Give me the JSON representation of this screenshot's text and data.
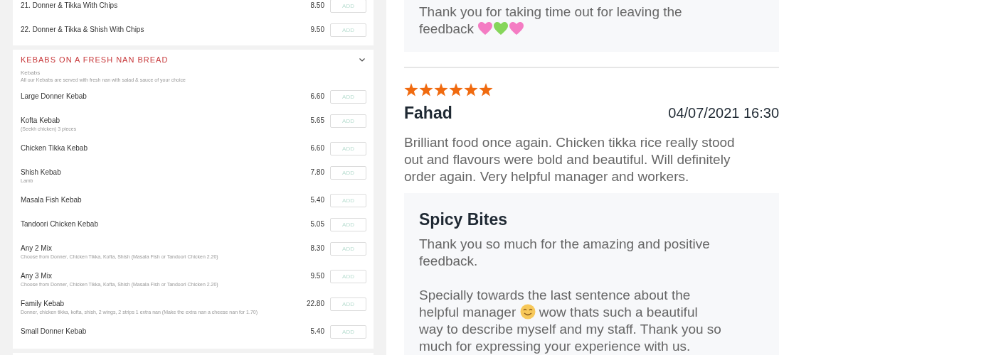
{
  "menu": {
    "previous_items": [
      {
        "name": "21. Donner & Tikka With Chips",
        "price": "8.50",
        "button": "ADD"
      },
      {
        "name": "22. Donner & Tikka & Shish With Chips",
        "price": "9.50",
        "button": "ADD"
      }
    ],
    "section": {
      "title": "KEBABS ON A FRESH NAN BREAD",
      "expanded": true,
      "category": "Kebabs",
      "description": "All our Kebabs are served with fresh nan with salad & sauce of your choice",
      "items": [
        {
          "name": "Large Donner Kebab",
          "price": "6.60",
          "button": "ADD"
        },
        {
          "name": "Kofta Kebab",
          "note": "(Seekh chicken) 3 pieces",
          "price": "5.65",
          "button": "ADD"
        },
        {
          "name": "Chicken Tikka Kebab",
          "price": "6.60",
          "button": "ADD"
        },
        {
          "name": "Shish Kebab",
          "note": "Lamb",
          "price": "7.80",
          "button": "ADD"
        },
        {
          "name": "Masala Fish Kebab",
          "price": "5.40",
          "button": "ADD"
        },
        {
          "name": "Tandoori Chicken Kebab",
          "price": "5.05",
          "button": "ADD"
        },
        {
          "name": "Any 2 Mix",
          "note": "Choose from Donner, Chicken Tikka, Kofta, Shish (Masala Fish or Tandoori Chicken 2.20)",
          "price": "8.30",
          "button": "ADD"
        },
        {
          "name": "Any 3 Mix",
          "note": "Choose from Donner, Chicken Tikka, Kofta, Shish (Masala Fish or Tandoori Chicken 2.20)",
          "price": "9.50",
          "button": "ADD"
        },
        {
          "name": "Family Kebab",
          "note": "Donner, chicken tikka, kofta, shish, 2 wings, 2 strips 1 extra nan (Make the extra nan a cheese nan for 1.70)",
          "price": "22.80",
          "button": "ADD"
        },
        {
          "name": "Small Donner Kebab",
          "price": "5.40",
          "button": "ADD"
        }
      ]
    }
  },
  "reviews": {
    "previous_reply": {
      "paragraphs": [
        [
          {
            "kind": "text",
            "text": "Thank you for taking time out for leaving the"
          },
          {
            "kind": "text",
            "text": "feedback"
          },
          {
            "kind": "heart",
            "color": "#f47cc3"
          },
          {
            "kind": "heart",
            "color": "#86d65a"
          },
          {
            "kind": "heart",
            "color": "#f47cc3"
          }
        ]
      ]
    },
    "review": {
      "stars": 6,
      "author": "Fahad",
      "date": "04/07/2021 16:30",
      "text": "Brilliant food once again. Chicken tikka rice really stood out and flavours were bold and beautiful. Will definitely order again. Very helpful manager and workers.",
      "reply": {
        "author": "Spicy Bites",
        "paragraphs": [
          [
            {
              "kind": "text",
              "text": "Thank you so much for the amazing and positive"
            },
            {
              "kind": "text",
              "text": "feedback."
            }
          ],
          [
            {
              "kind": "text",
              "text": "Specially towards the last sentence about the"
            },
            {
              "kind": "text",
              "text": "helpful manager"
            },
            {
              "kind": "smile"
            },
            {
              "kind": "text",
              "text": "wow thats such a beautiful"
            },
            {
              "kind": "text",
              "text": "way to describe myself and my staff. Thank you so"
            },
            {
              "kind": "text",
              "text": "much for expressing your experience with us."
            }
          ]
        ]
      }
    }
  }
}
